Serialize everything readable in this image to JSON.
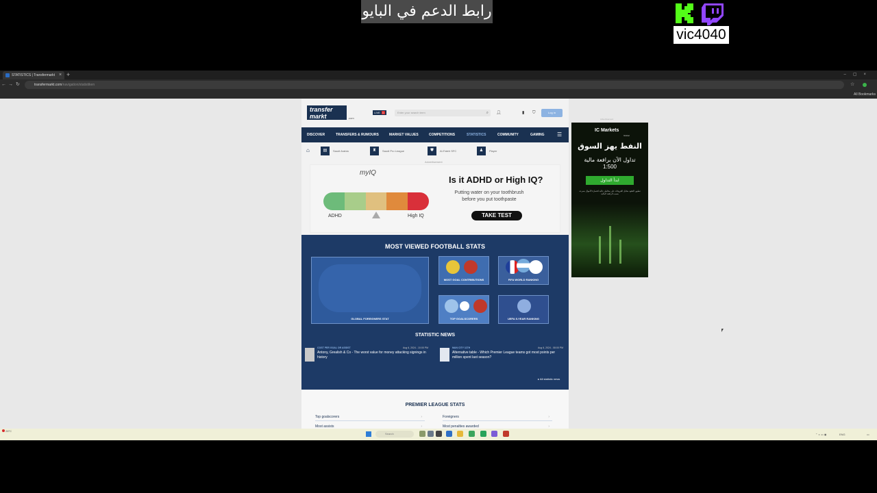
{
  "overlay": {
    "banner_text": "رابط الدعم في البايو",
    "streamer_name": "vic4040",
    "kick_logo_color": "#53fc18",
    "twitch_logo_color": "#9146ff"
  },
  "browser": {
    "tab_title": "STATISTICS | Transfermarkt",
    "url_domain": "transfermarkt.com",
    "url_path": "/navigation/statistiken",
    "bookmarks_label": "All Bookmarks"
  },
  "site": {
    "logo_line1": "transfer",
    "logo_line2": "markt",
    "logo_sub": ".com",
    "live_label": "LIVE",
    "live_count": "0",
    "search_placeholder": "Enter your search term",
    "login_label": "Log in",
    "nav": [
      "DISCOVER",
      "TRANSFERS & RUMOURS",
      "MARKET VALUES",
      "COMPETITIONS",
      "STATISTICS",
      "COMMUNITY",
      "GAMING"
    ],
    "breadcrumb": [
      "Saudi Arabia",
      "Saudi Pro League",
      "Al-Fateh SFC",
      "Player"
    ],
    "ad_label": "Advertisement"
  },
  "myiq_ad": {
    "brand": "myIQ",
    "headline": "Is it ADHD or High IQ?",
    "subtext": "Putting water on your toothbrush before you put toothpaste",
    "left_label": "ADHD",
    "right_label": "High IQ",
    "cta": "TAKE TEST",
    "scale_colors": [
      "#6dbb7a",
      "#a8cd8a",
      "#e0c07f",
      "#e08a3c",
      "#d9303a"
    ]
  },
  "stats": {
    "title": "MOST VIEWED FOOTBALL STATS",
    "cards": [
      {
        "label": "GLOBAL FOREIGNERS STAT"
      },
      {
        "label": "MOST GOAL CONTRIBUTIONS"
      },
      {
        "label": "FIFA WORLD RANKING"
      },
      {
        "label": "TOP GOALSCORERS"
      },
      {
        "label": "UEFA 5-YEAR RANKING"
      }
    ],
    "news_title": "STATISTIC NEWS",
    "news": [
      {
        "category": "COST PER GOAL OR ASSIST",
        "date": "Aug 6, 2024 - 10:00 PM",
        "headline": "Antony, Grealish & Co - The worst value for money attacking signings in history"
      },
      {
        "category": "MAN CITY 11TH",
        "date": "Aug 6, 2024 - 08:00 PM",
        "headline": "Alternative table - Which Premier League teams got most points per million spent last season?"
      }
    ],
    "all_news_label": "All statistic news"
  },
  "pl_stats": {
    "title": "PREMIER LEAGUE STATS",
    "rows": [
      "Top goalscorers",
      "Foreigners",
      "Most assists",
      "Most penalties awarded"
    ]
  },
  "right_ad": {
    "brand": "IC Markets",
    "brand_sub": "Global",
    "headline": "النفط يهز السوق",
    "subline": "تداول الآن برافعة مالية",
    "leverage": "1:500",
    "cta": "ابدأ التداول",
    "disclaimer": "تنطوي العقود مقابل الفروقات على مخاطر عالية لخسارة الأموال بسرعة بسبب الرافعة المالية"
  },
  "taskbar": {
    "weather_temp": "28°C",
    "search_label": "Search",
    "language": "ENG"
  }
}
